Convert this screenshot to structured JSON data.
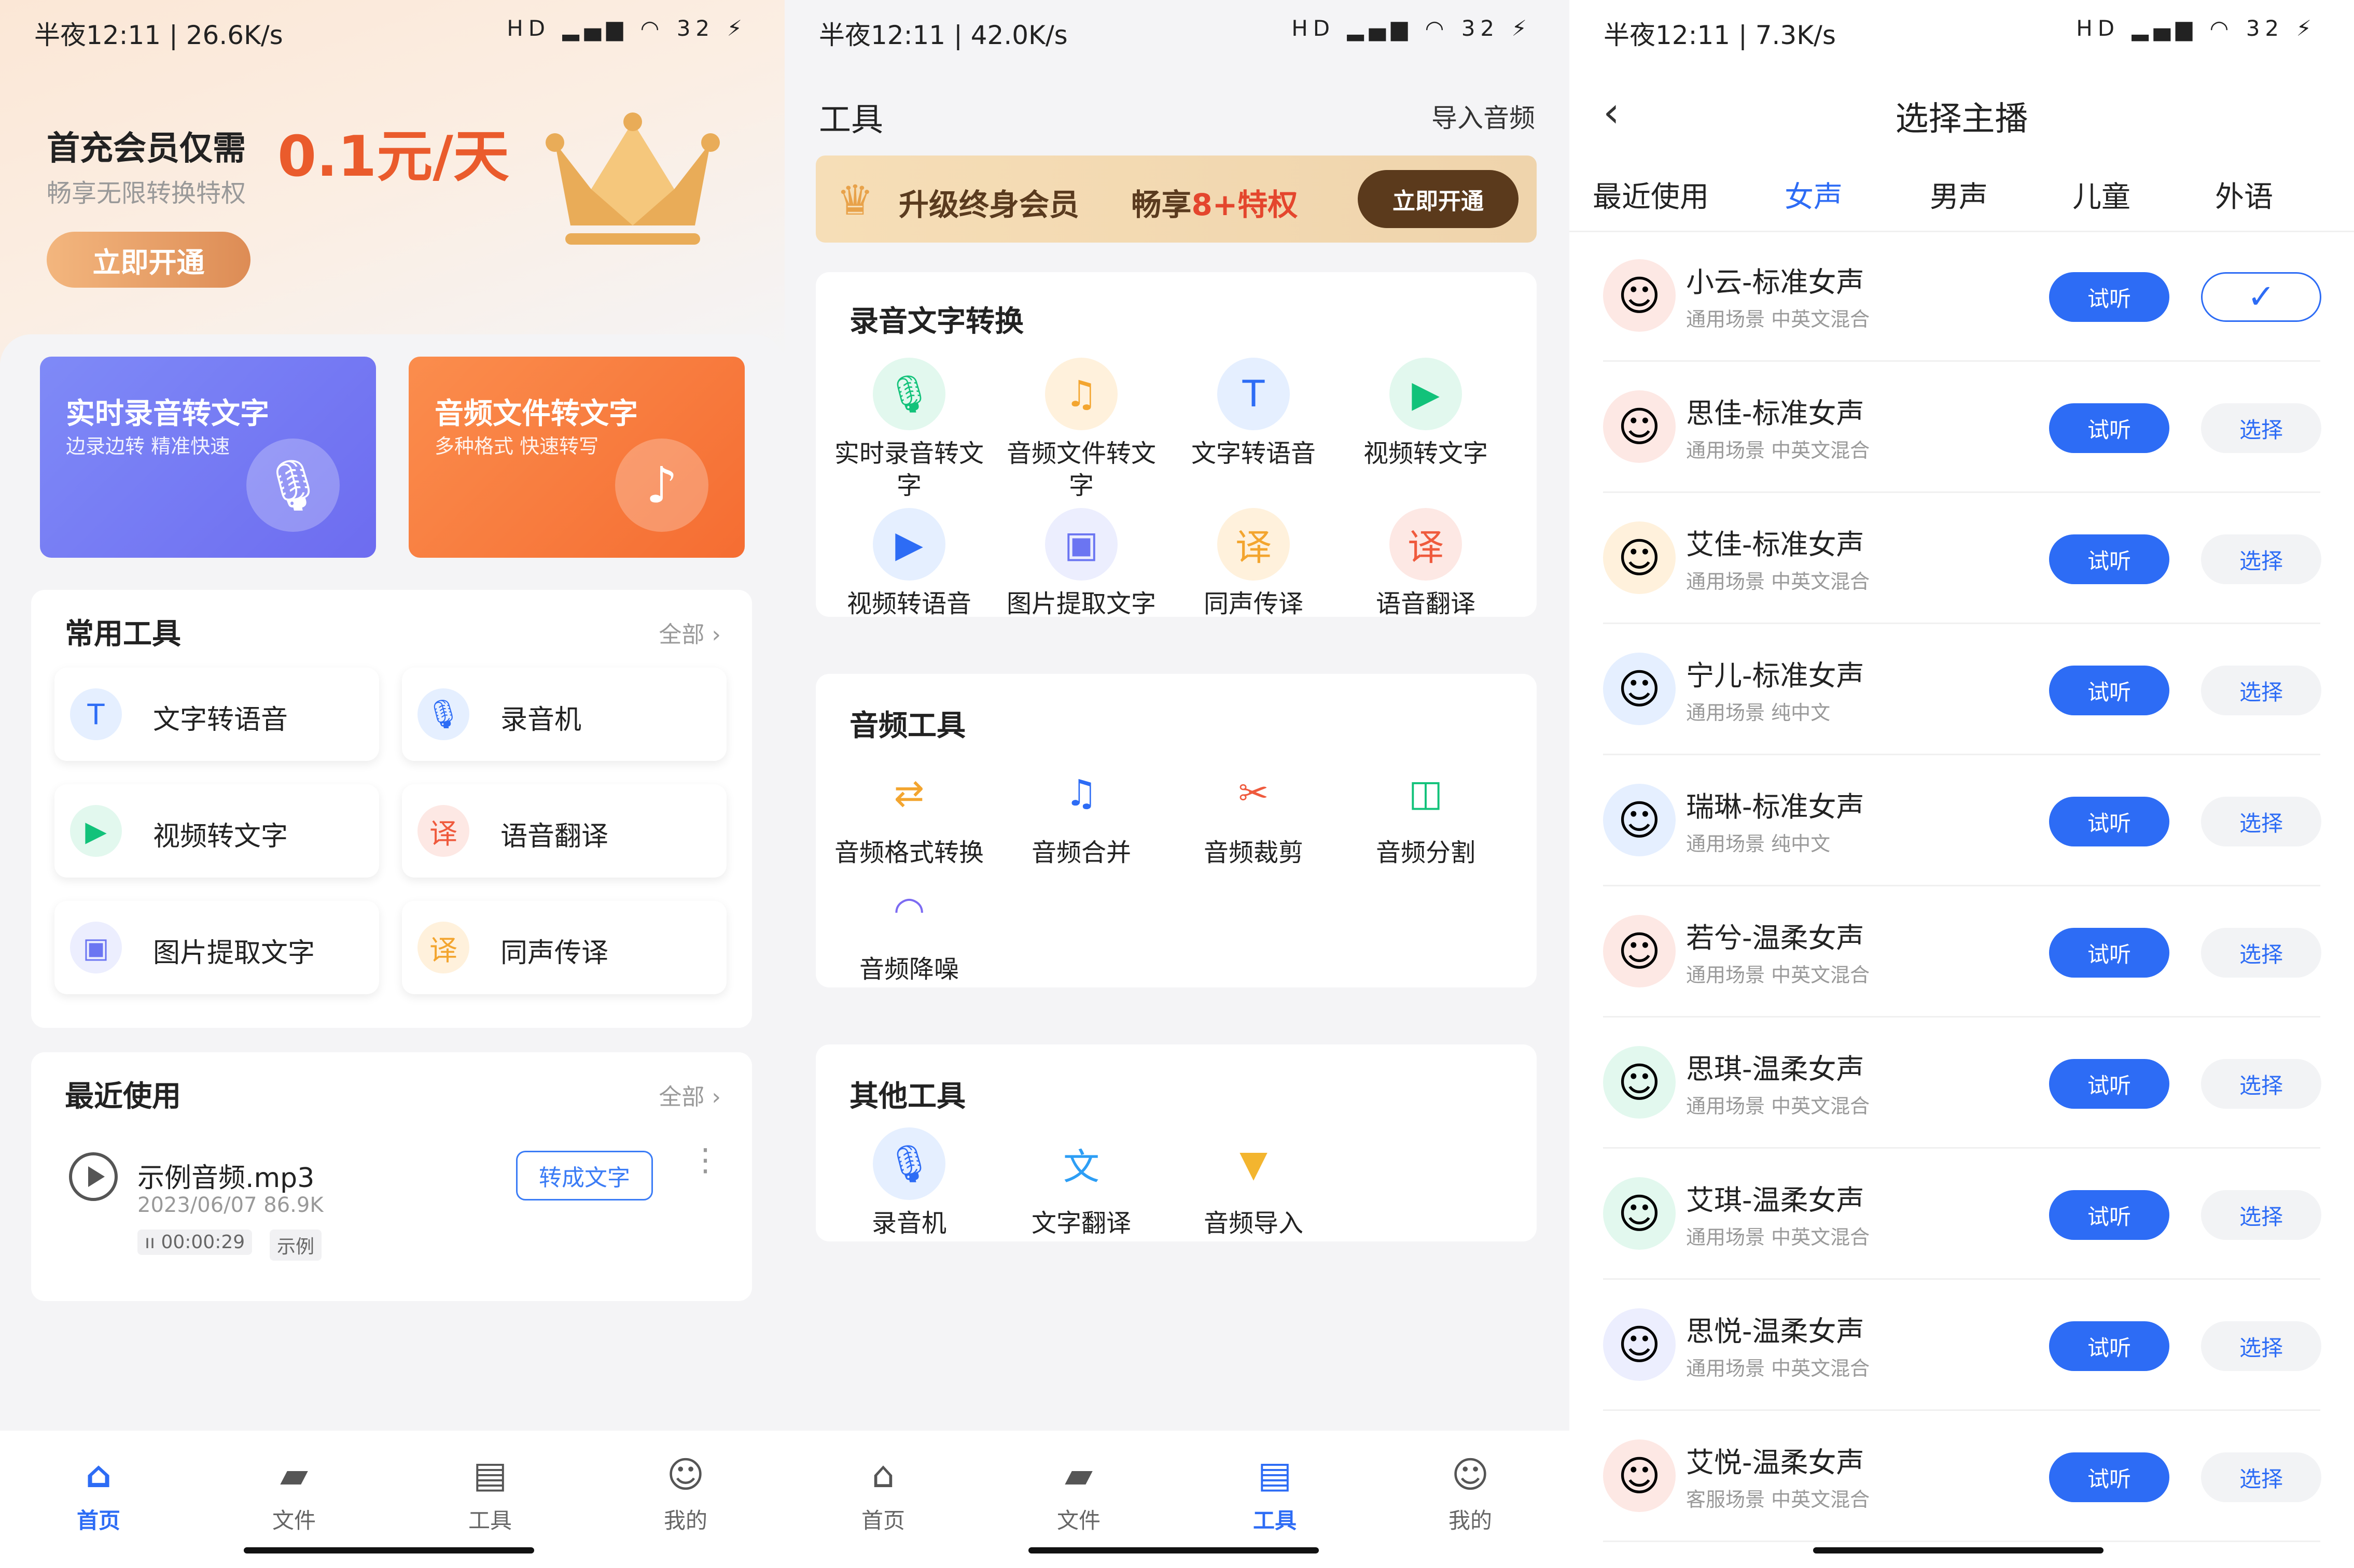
{
  "colors": {
    "accent": "#2d6cf5",
    "promo_price": "#ea5b2c",
    "vip_dark": "#5b3a1c",
    "card_purple": "#7b7ef5",
    "card_orange": "#f67a3a"
  },
  "status_bars": [
    {
      "text": "半夜12:11 | 26.6K/s",
      "icons": "HD ▂▄▆ ◠ 32 ⚡"
    },
    {
      "text": "半夜12:11 | 42.0K/s",
      "icons": "HD ▂▄▆ ◠ 32 ⚡"
    },
    {
      "text": "半夜12:11 | 7.3K/s",
      "icons": "HD ▂▄▆ ◠ 32 ⚡"
    }
  ],
  "home": {
    "promo": {
      "title": "首充会员仅需",
      "price": "0.1元/天",
      "subtitle": "畅享无限转换特权",
      "button": "立即开通"
    },
    "big_cards": [
      {
        "title": "实时录音转文字",
        "subtitle": "边录边转  精准快速",
        "icon": "mic-icon"
      },
      {
        "title": "音频文件转文字",
        "subtitle": "多种格式  快速转写",
        "icon": "music-file-icon"
      }
    ],
    "common_tools": {
      "heading": "常用工具",
      "more": "全部 ›",
      "items": [
        {
          "label": "文字转语音",
          "icon": "text-to-speech-icon"
        },
        {
          "label": "录音机",
          "icon": "recorder-icon"
        },
        {
          "label": "视频转文字",
          "icon": "video-icon"
        },
        {
          "label": "语音翻译",
          "icon": "voice-translate-icon"
        },
        {
          "label": "图片提取文字",
          "icon": "image-icon"
        },
        {
          "label": "同声传译",
          "icon": "interpret-icon"
        }
      ]
    },
    "recent": {
      "heading": "最近使用",
      "more": "全部 ›",
      "file": {
        "name": "示例音频.mp3",
        "meta": "2023/06/07 86.9K",
        "duration": "ıı 00:00:29",
        "tag": "示例",
        "action": "转成文字"
      }
    }
  },
  "tools": {
    "title": "工具",
    "import": "导入音频",
    "vip": {
      "text": "升级终身会员",
      "highlight_prefix": "畅享",
      "highlight": "8+特权",
      "button": "立即开通"
    },
    "sections": [
      {
        "heading": "录音文字转换",
        "items": [
          {
            "label": "实时录音转文字",
            "icon": "mic-icon"
          },
          {
            "label": "音频文件转文字",
            "icon": "music-file-icon"
          },
          {
            "label": "文字转语音",
            "icon": "text-to-speech-icon"
          },
          {
            "label": "视频转文字",
            "icon": "video-icon"
          },
          {
            "label": "视频转语音",
            "icon": "video-audio-icon"
          },
          {
            "label": "图片提取文字",
            "icon": "image-icon"
          },
          {
            "label": "同声传译",
            "icon": "interpret-icon"
          },
          {
            "label": "语音翻译",
            "icon": "voice-translate-icon"
          }
        ]
      },
      {
        "heading": "音频工具",
        "items": [
          {
            "label": "音频格式转换",
            "icon": "convert-icon"
          },
          {
            "label": "音频合并",
            "icon": "merge-icon"
          },
          {
            "label": "音频裁剪",
            "icon": "cut-icon"
          },
          {
            "label": "音频分割",
            "icon": "split-icon"
          },
          {
            "label": "音频降噪",
            "icon": "denoise-icon"
          }
        ]
      },
      {
        "heading": "其他工具",
        "items": [
          {
            "label": "录音机",
            "icon": "recorder-icon"
          },
          {
            "label": "文字翻译",
            "icon": "text-translate-icon"
          },
          {
            "label": "音频导入",
            "icon": "import-icon"
          }
        ]
      }
    ]
  },
  "nav": [
    {
      "label": "首页",
      "icon": "home-icon"
    },
    {
      "label": "文件",
      "icon": "folder-icon"
    },
    {
      "label": "工具",
      "icon": "toolbox-icon"
    },
    {
      "label": "我的",
      "icon": "profile-icon"
    }
  ],
  "anchor": {
    "title": "选择主播",
    "tabs": [
      "最近使用",
      "女声",
      "男声",
      "儿童",
      "外语"
    ],
    "active_tab": "女声",
    "listen_label": "试听",
    "select_label": "选择",
    "checked_mark": "✓",
    "voices": [
      {
        "name": "小云-标准女声",
        "desc": "通用场景  中英文混合",
        "selected": true
      },
      {
        "name": "思佳-标准女声",
        "desc": "通用场景  中英文混合",
        "selected": false
      },
      {
        "name": "艾佳-标准女声",
        "desc": "通用场景  中英文混合",
        "selected": false
      },
      {
        "name": "宁儿-标准女声",
        "desc": "通用场景  纯中文",
        "selected": false
      },
      {
        "name": "瑞琳-标准女声",
        "desc": "通用场景  纯中文",
        "selected": false
      },
      {
        "name": "若兮-温柔女声",
        "desc": "通用场景  中英文混合",
        "selected": false
      },
      {
        "name": "思琪-温柔女声",
        "desc": "通用场景  中英文混合",
        "selected": false
      },
      {
        "name": "艾琪-温柔女声",
        "desc": "通用场景  中英文混合",
        "selected": false
      },
      {
        "name": "思悦-温柔女声",
        "desc": "通用场景  中英文混合",
        "selected": false
      },
      {
        "name": "艾悦-温柔女声",
        "desc": "客服场景  中英文混合",
        "selected": false
      }
    ]
  }
}
